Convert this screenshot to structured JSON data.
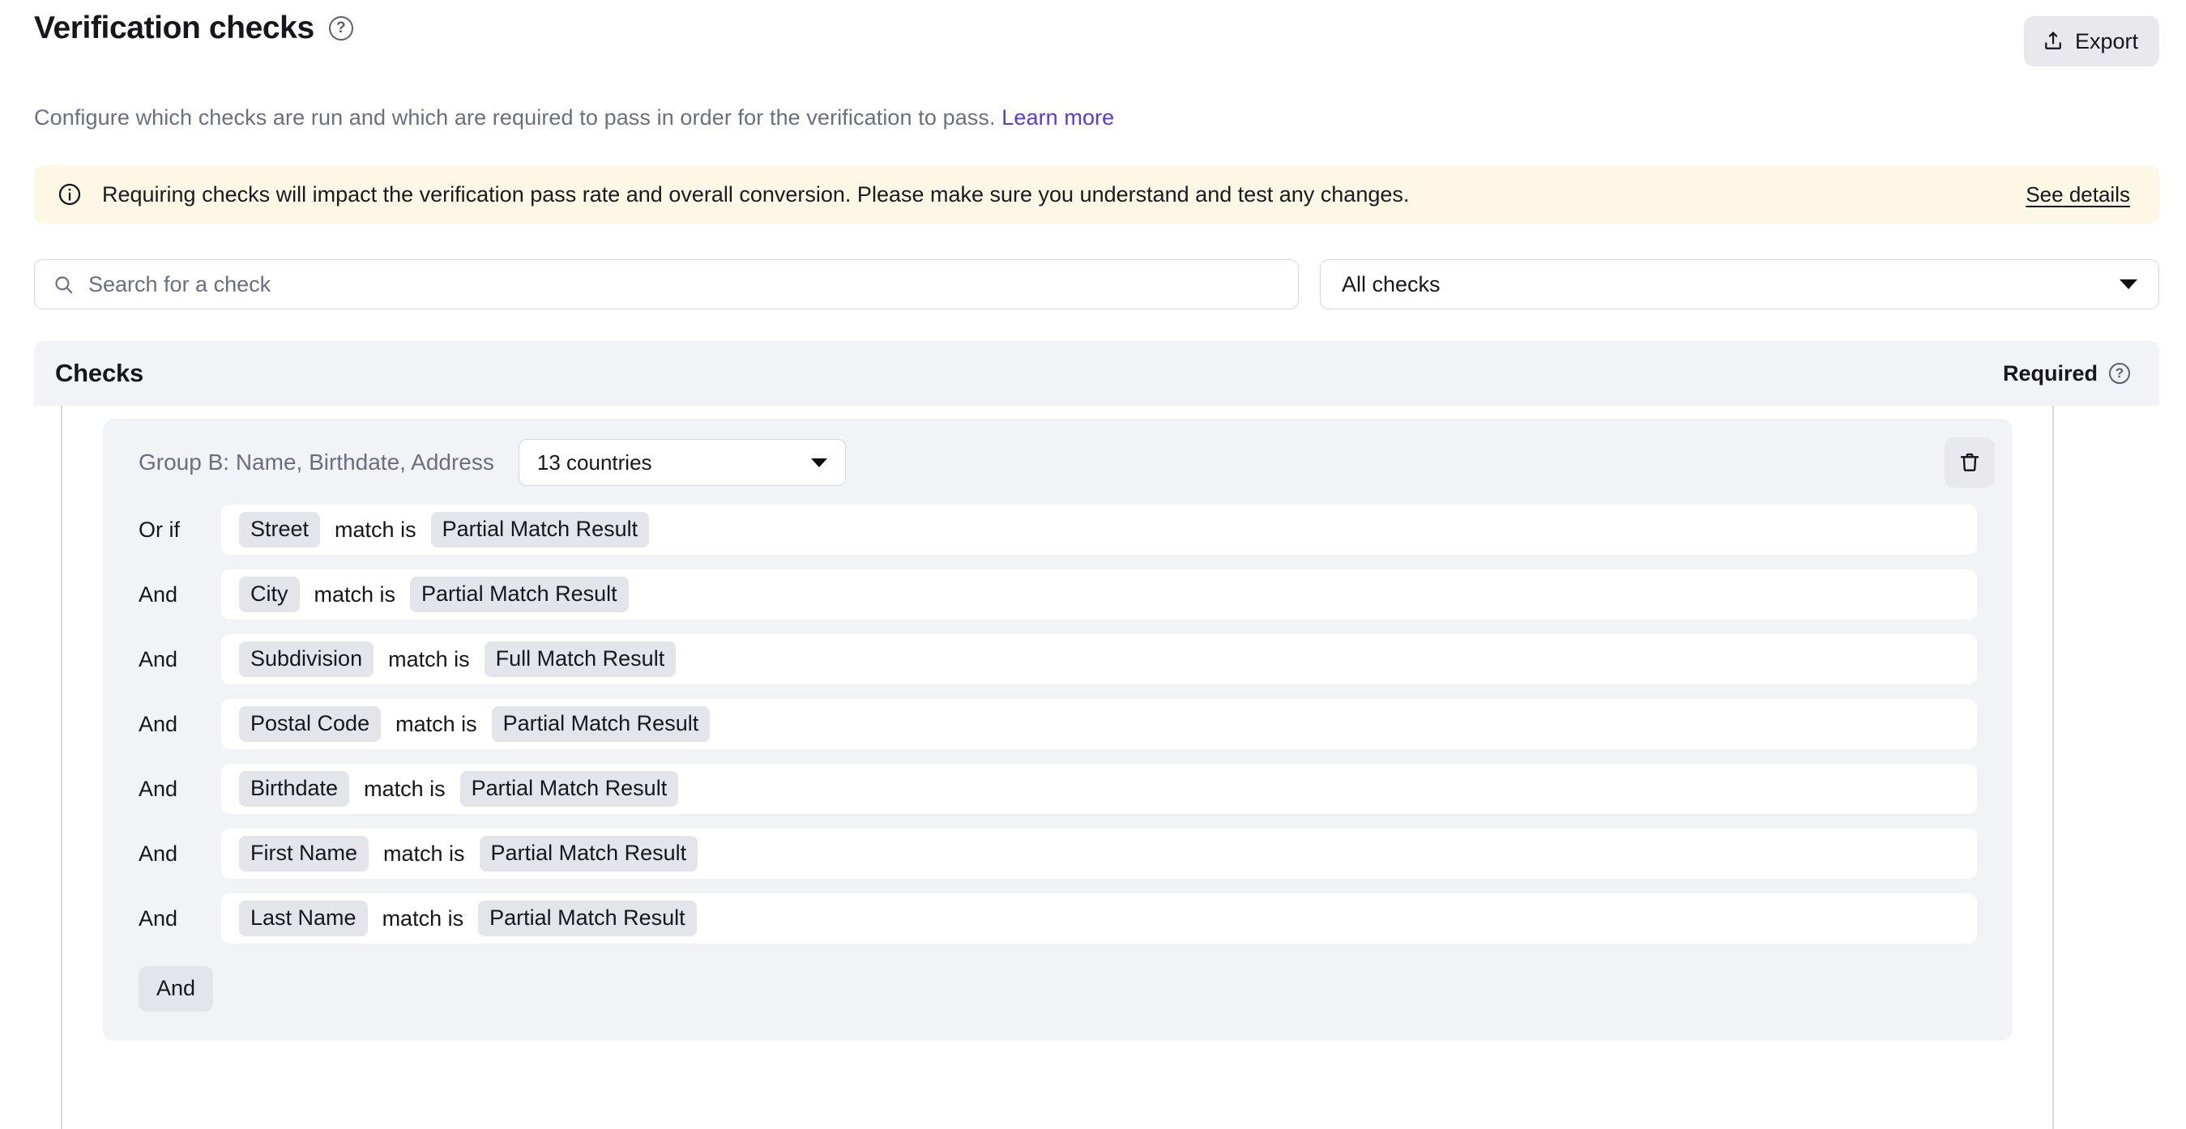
{
  "header": {
    "title": "Verification checks",
    "help_icon": "question-circle-icon",
    "export_label": "Export",
    "export_icon": "upload-export-icon"
  },
  "subtitle": {
    "text": "Configure which checks are run and which are required to pass in order for the verification to pass.",
    "link_label": "Learn more"
  },
  "banner": {
    "icon": "info-circle-icon",
    "message": "Requiring checks will impact the verification pass rate and overall conversion. Please make sure you understand and test any changes.",
    "action_label": "See details",
    "background_color": "#fdf7e6"
  },
  "filters": {
    "search_placeholder": "Search for a check",
    "search_value": "",
    "search_icon": "search-icon",
    "filter_selected": "All checks",
    "filter_icon": "chevron-down-icon"
  },
  "checks_section": {
    "title": "Checks",
    "required_label": "Required",
    "required_help_icon": "question-circle-icon"
  },
  "group": {
    "name": "Group B: Name, Birthdate, Address",
    "countries_selected": "13 countries",
    "delete_icon": "trash-icon",
    "add_condition_label": "And",
    "conditions": [
      {
        "conjunction": "Or if",
        "field": "Street",
        "operator": "match is",
        "value": "Partial Match Result"
      },
      {
        "conjunction": "And",
        "field": "City",
        "operator": "match is",
        "value": "Partial Match Result"
      },
      {
        "conjunction": "And",
        "field": "Subdivision",
        "operator": "match is",
        "value": "Full Match Result"
      },
      {
        "conjunction": "And",
        "field": "Postal Code",
        "operator": "match is",
        "value": "Partial Match Result"
      },
      {
        "conjunction": "And",
        "field": "Birthdate",
        "operator": "match is",
        "value": "Partial Match Result"
      },
      {
        "conjunction": "And",
        "field": "First Name",
        "operator": "match is",
        "value": "Partial Match Result"
      },
      {
        "conjunction": "And",
        "field": "Last Name",
        "operator": "match is",
        "value": "Partial Match Result"
      }
    ]
  },
  "colors": {
    "link": "#5b36e8",
    "banner_bg": "#fdf7e6",
    "panel_bg": "#f2f3f6",
    "chip_bg": "#e4e4eb",
    "muted_text": "#6b6e83"
  }
}
